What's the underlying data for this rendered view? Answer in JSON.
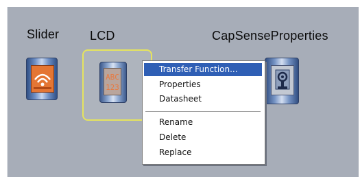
{
  "components": {
    "slider": {
      "label": "Slider",
      "icon": "slider-component-icon"
    },
    "lcd": {
      "label": "LCD",
      "icon": "lcd-component-icon",
      "screen_text": "ABC\n123"
    },
    "capsense": {
      "label": "CapSenseProperties",
      "icon": "capsense-component-icon"
    }
  },
  "context_menu": {
    "items": [
      {
        "label": "Transfer Function...",
        "selected": true
      },
      {
        "label": "Properties"
      },
      {
        "label": "Datasheet"
      },
      {
        "label": "Rename"
      },
      {
        "label": "Delete"
      },
      {
        "label": "Replace"
      }
    ]
  },
  "colors": {
    "canvas_bg": "#a7adb8",
    "selection_frame": "#e6e45d",
    "menu_highlight": "#2f5fb5",
    "accent_orange": "#e47634"
  }
}
